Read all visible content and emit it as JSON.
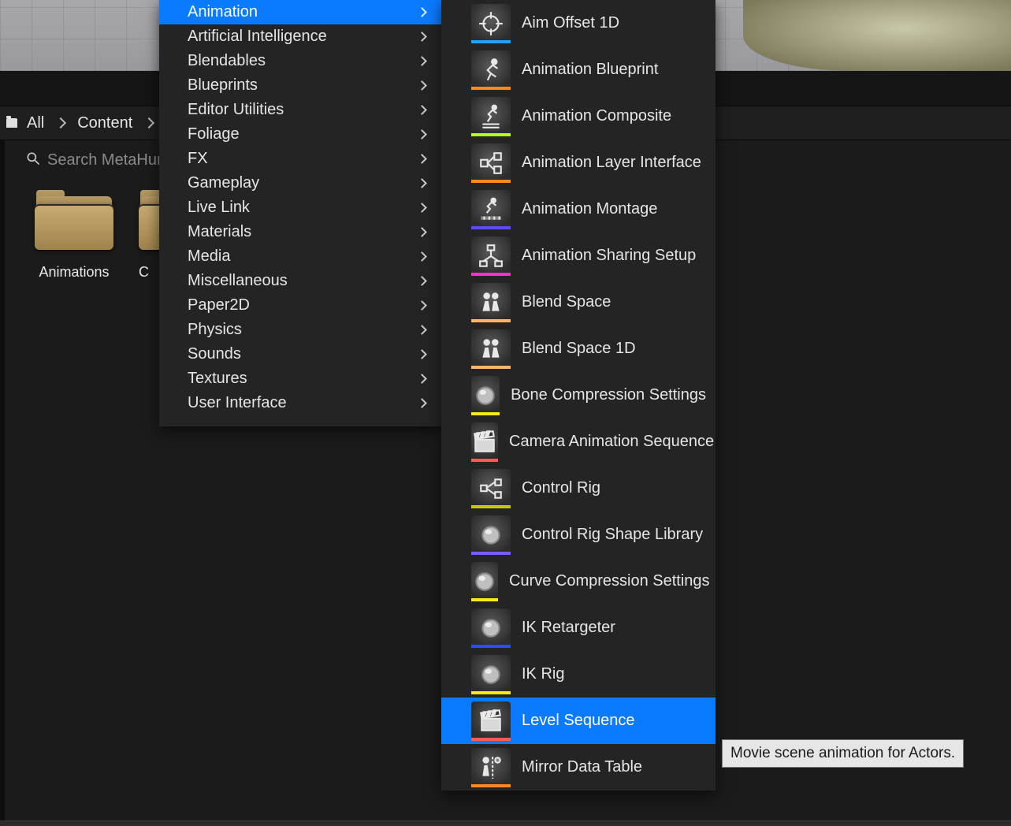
{
  "breadcrumb": {
    "all": "All",
    "content": "Content"
  },
  "search": {
    "placeholder": "Search MetaHuman"
  },
  "folders": [
    {
      "label": "Animations"
    },
    {
      "label": "C"
    }
  ],
  "categories": [
    {
      "label": "Animation",
      "selected": true
    },
    {
      "label": "Artificial Intelligence"
    },
    {
      "label": "Blendables"
    },
    {
      "label": "Blueprints"
    },
    {
      "label": "Editor Utilities"
    },
    {
      "label": "Foliage"
    },
    {
      "label": "FX"
    },
    {
      "label": "Gameplay"
    },
    {
      "label": "Live Link"
    },
    {
      "label": "Materials"
    },
    {
      "label": "Media"
    },
    {
      "label": "Miscellaneous"
    },
    {
      "label": "Paper2D"
    },
    {
      "label": "Physics"
    },
    {
      "label": "Sounds"
    },
    {
      "label": "Textures"
    },
    {
      "label": "User Interface"
    }
  ],
  "submenu": [
    {
      "label": "Aim Offset 1D",
      "icon": "crosshair",
      "stripe": "#1aa3ff"
    },
    {
      "label": "Animation Blueprint",
      "icon": "runner",
      "stripe": "#ff8a1a"
    },
    {
      "label": "Animation Composite",
      "icon": "runner-stack",
      "stripe": "#b6ff1a"
    },
    {
      "label": "Animation Layer Interface",
      "icon": "layers-node",
      "stripe": "#ff8a1a"
    },
    {
      "label": "Animation Montage",
      "icon": "runner-timeline",
      "stripe": "#5a4bff"
    },
    {
      "label": "Animation Sharing Setup",
      "icon": "share-graph",
      "stripe": "#ff2ecc"
    },
    {
      "label": "Blend Space",
      "icon": "people",
      "stripe": "#ffb56b"
    },
    {
      "label": "Blend Space 1D",
      "icon": "people",
      "stripe": "#ffb56b"
    },
    {
      "label": "Bone Compression Settings",
      "icon": "sphere",
      "stripe": "#ffe81a"
    },
    {
      "label": "Camera Animation Sequence",
      "icon": "clapper",
      "stripe": "#ff5a5a"
    },
    {
      "label": "Control Rig",
      "icon": "rig-node",
      "stripe": "#c7cc00"
    },
    {
      "label": "Control Rig Shape Library",
      "icon": "sphere",
      "stripe": "#7a5bff"
    },
    {
      "label": "Curve Compression Settings",
      "icon": "sphere",
      "stripe": "#ffe81a"
    },
    {
      "label": "IK Retargeter",
      "icon": "sphere",
      "stripe": "#2e4bff"
    },
    {
      "label": "IK Rig",
      "icon": "sphere",
      "stripe": "#ffe81a"
    },
    {
      "label": "Level Sequence",
      "icon": "clapper",
      "stripe": "#ff5a5a",
      "selected": true
    },
    {
      "label": "Mirror Data Table",
      "icon": "mirror",
      "stripe": "#ff8a1a"
    }
  ],
  "tooltip": "Movie scene animation for Actors."
}
